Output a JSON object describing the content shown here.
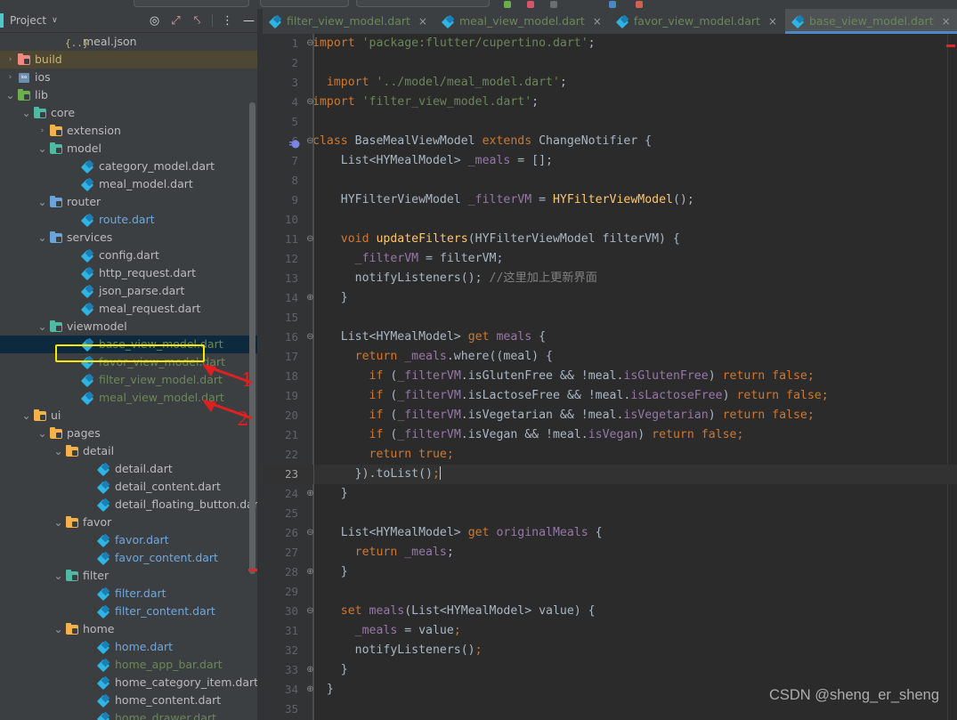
{
  "app": {
    "watermark": "CSDN @sheng_er_sheng"
  },
  "project_panel": {
    "title": "Project",
    "caret": "∨",
    "icons": [
      {
        "name": "target-icon",
        "glyph": "◎"
      },
      {
        "name": "expand-all-icon",
        "glyph": "⤢"
      },
      {
        "name": "collapse-all-icon",
        "glyph": "⤣"
      },
      {
        "name": "more-options-icon",
        "glyph": "⋮"
      },
      {
        "name": "minimize-icon",
        "glyph": "—"
      }
    ],
    "tree": [
      {
        "indent": 3,
        "arrow": "",
        "icon": "json-file-icon",
        "label": "meal.json",
        "color": "c-grey"
      },
      {
        "indent": 0,
        "arrow": ">",
        "icon": "folder-red-icon",
        "label": "build",
        "color": "c-yellow",
        "highlight": "build"
      },
      {
        "indent": 0,
        "arrow": ">",
        "icon": "ios-icon",
        "label": "ios",
        "color": "c-grey"
      },
      {
        "indent": 0,
        "arrow": "v",
        "icon": "folder-green-icon",
        "label": "lib",
        "color": "c-grey"
      },
      {
        "indent": 1,
        "arrow": "v",
        "icon": "folder-teal-icon",
        "label": "core",
        "color": "c-grey"
      },
      {
        "indent": 2,
        "arrow": ">",
        "icon": "folder-orange-icon",
        "label": "extension",
        "color": "c-grey"
      },
      {
        "indent": 2,
        "arrow": "v",
        "icon": "folder-teal-icon",
        "label": "model",
        "color": "c-grey"
      },
      {
        "indent": 4,
        "arrow": "",
        "icon": "dart-file-icon",
        "label": "category_model.dart",
        "color": "c-grey"
      },
      {
        "indent": 4,
        "arrow": "",
        "icon": "dart-file-icon",
        "label": "meal_model.dart",
        "color": "c-grey"
      },
      {
        "indent": 2,
        "arrow": "v",
        "icon": "folder-blue-icon",
        "label": "router",
        "color": "c-grey"
      },
      {
        "indent": 4,
        "arrow": "",
        "icon": "dart-file-icon",
        "label": "route.dart",
        "color": "c-blue"
      },
      {
        "indent": 2,
        "arrow": "v",
        "icon": "folder-blue-icon",
        "label": "services",
        "color": "c-grey"
      },
      {
        "indent": 4,
        "arrow": "",
        "icon": "dart-file-icon",
        "label": "config.dart",
        "color": "c-grey"
      },
      {
        "indent": 4,
        "arrow": "",
        "icon": "dart-file-icon",
        "label": "http_request.dart",
        "color": "c-grey"
      },
      {
        "indent": 4,
        "arrow": "",
        "icon": "dart-file-icon",
        "label": "json_parse.dart",
        "color": "c-grey"
      },
      {
        "indent": 4,
        "arrow": "",
        "icon": "dart-file-icon",
        "label": "meal_request.dart",
        "color": "c-grey"
      },
      {
        "indent": 2,
        "arrow": "v",
        "icon": "folder-teal-icon",
        "label": "viewmodel",
        "color": "c-grey"
      },
      {
        "indent": 4,
        "arrow": "",
        "icon": "dart-file-icon",
        "label": "base_view_model.dart",
        "color": "c-green",
        "selected": true
      },
      {
        "indent": 4,
        "arrow": "",
        "icon": "dart-file-icon",
        "label": "favor_view_model.dart",
        "color": "c-green"
      },
      {
        "indent": 4,
        "arrow": "",
        "icon": "dart-file-icon",
        "label": "filter_view_model.dart",
        "color": "c-green"
      },
      {
        "indent": 4,
        "arrow": "",
        "icon": "dart-file-icon",
        "label": "meal_view_model.dart",
        "color": "c-green"
      },
      {
        "indent": 1,
        "arrow": "v",
        "icon": "folder-orange-icon",
        "label": "ui",
        "color": "c-grey"
      },
      {
        "indent": 2,
        "arrow": "v",
        "icon": "folder-orange-icon",
        "label": "pages",
        "color": "c-grey"
      },
      {
        "indent": 3,
        "arrow": "v",
        "icon": "folder-orange-icon",
        "label": "detail",
        "color": "c-grey"
      },
      {
        "indent": 5,
        "arrow": "",
        "icon": "dart-file-icon",
        "label": "detail.dart",
        "color": "c-grey"
      },
      {
        "indent": 5,
        "arrow": "",
        "icon": "dart-file-icon",
        "label": "detail_content.dart",
        "color": "c-grey"
      },
      {
        "indent": 5,
        "arrow": "",
        "icon": "dart-file-icon",
        "label": "detail_floating_button.dart",
        "color": "c-grey"
      },
      {
        "indent": 3,
        "arrow": "v",
        "icon": "folder-orange-icon",
        "label": "favor",
        "color": "c-grey"
      },
      {
        "indent": 5,
        "arrow": "",
        "icon": "dart-file-icon",
        "label": "favor.dart",
        "color": "c-blue"
      },
      {
        "indent": 5,
        "arrow": "",
        "icon": "dart-file-icon",
        "label": "favor_content.dart",
        "color": "c-blue"
      },
      {
        "indent": 3,
        "arrow": "v",
        "icon": "folder-teal-icon",
        "label": "filter",
        "color": "c-grey"
      },
      {
        "indent": 5,
        "arrow": "",
        "icon": "dart-file-icon",
        "label": "filter.dart",
        "color": "c-blue"
      },
      {
        "indent": 5,
        "arrow": "",
        "icon": "dart-file-icon",
        "label": "filter_content.dart",
        "color": "c-blue"
      },
      {
        "indent": 3,
        "arrow": "v",
        "icon": "folder-orange-icon",
        "label": "home",
        "color": "c-grey"
      },
      {
        "indent": 5,
        "arrow": "",
        "icon": "dart-file-icon",
        "label": "home.dart",
        "color": "c-blue"
      },
      {
        "indent": 5,
        "arrow": "",
        "icon": "dart-file-icon",
        "label": "home_app_bar.dart",
        "color": "c-green"
      },
      {
        "indent": 5,
        "arrow": "",
        "icon": "dart-file-icon",
        "label": "home_category_item.dart",
        "color": "c-grey"
      },
      {
        "indent": 5,
        "arrow": "",
        "icon": "dart-file-icon",
        "label": "home_content.dart",
        "color": "c-grey"
      },
      {
        "indent": 5,
        "arrow": "",
        "icon": "dart-file-icon",
        "label": "home_drawer.dart",
        "color": "c-green"
      }
    ],
    "annotations": [
      {
        "name": "annotation-number-1",
        "label": "1"
      },
      {
        "name": "annotation-number-2",
        "label": "2"
      }
    ],
    "selection_highlight_color": "#ffe600",
    "annotation_color": "#e02020"
  },
  "editor": {
    "tabs": [
      {
        "label": "filter_view_model.dart",
        "color": "#6a8759",
        "active": false,
        "close": "×"
      },
      {
        "label": "meal_view_model.dart",
        "color": "#6a8759",
        "active": false,
        "close": "×"
      },
      {
        "label": "favor_view_model.dart",
        "color": "#6a8759",
        "active": false,
        "close": "×"
      },
      {
        "label": "base_view_model.dart",
        "color": "#6a8759",
        "active": true,
        "close": "×"
      }
    ],
    "current_line": 23,
    "lines": [
      {
        "n": 1,
        "fold": "⊖",
        "tokens": [
          {
            "t": "import ",
            "c": "k"
          },
          {
            "t": "'package:flutter/cupertino.dart'",
            "c": "s"
          },
          {
            "t": ";",
            "c": "pn"
          }
        ]
      },
      {
        "n": 2,
        "fold": "",
        "tokens": []
      },
      {
        "n": 3,
        "fold": "",
        "indent": 1,
        "tokens": [
          {
            "t": "import ",
            "c": "k"
          },
          {
            "t": "'../model/meal_model.dart'",
            "c": "s"
          },
          {
            "t": ";",
            "c": "pn"
          }
        ]
      },
      {
        "n": 4,
        "fold": "⊖",
        "tokens": [
          {
            "t": "import ",
            "c": "k"
          },
          {
            "t": "'filter_view_model.dart'",
            "c": "s"
          },
          {
            "t": ";",
            "c": "pn"
          }
        ]
      },
      {
        "n": 5,
        "fold": "",
        "tokens": []
      },
      {
        "n": 6,
        "fold": "⊖",
        "run": true,
        "tokens": [
          {
            "t": "class ",
            "c": "k"
          },
          {
            "t": "BaseMealViewModel ",
            "c": "ty"
          },
          {
            "t": "extends ",
            "c": "k"
          },
          {
            "t": "ChangeNotifier {",
            "c": "ty"
          }
        ]
      },
      {
        "n": 7,
        "fold": "",
        "indent": 2,
        "tokens": [
          {
            "t": "List<HYMealModel> ",
            "c": "ty"
          },
          {
            "t": "_meals",
            "c": "fd"
          },
          {
            "t": " = [];",
            "c": "pn"
          }
        ]
      },
      {
        "n": 8,
        "fold": "",
        "tokens": []
      },
      {
        "n": 9,
        "fold": "",
        "indent": 2,
        "tokens": [
          {
            "t": "HYFilterViewModel ",
            "c": "ty"
          },
          {
            "t": "_filterVM",
            "c": "fd"
          },
          {
            "t": " = ",
            "c": "pn"
          },
          {
            "t": "HYFilterViewModel",
            "c": "fn"
          },
          {
            "t": "();",
            "c": "pn"
          }
        ]
      },
      {
        "n": 10,
        "fold": "",
        "tokens": []
      },
      {
        "n": 11,
        "fold": "⊖",
        "indent": 2,
        "tokens": [
          {
            "t": "void ",
            "c": "k"
          },
          {
            "t": "updateFilters",
            "c": "fn"
          },
          {
            "t": "(HYFilterViewModel filterVM) {",
            "c": "pn"
          }
        ]
      },
      {
        "n": 12,
        "fold": "",
        "indent": 3,
        "tokens": [
          {
            "t": "_filterVM",
            "c": "fd"
          },
          {
            "t": " = filterVM;",
            "c": "pn"
          }
        ]
      },
      {
        "n": 13,
        "fold": "",
        "indent": 3,
        "tokens": [
          {
            "t": "notifyListeners",
            "c": "pn"
          },
          {
            "t": "(); ",
            "c": "pn"
          },
          {
            "t": "//这里加上更新界面",
            "c": "cm"
          }
        ]
      },
      {
        "n": 14,
        "fold": "⊕",
        "indent": 2,
        "tokens": [
          {
            "t": "}",
            "c": "pn"
          }
        ]
      },
      {
        "n": 15,
        "fold": "",
        "tokens": []
      },
      {
        "n": 16,
        "fold": "⊖",
        "indent": 2,
        "tokens": [
          {
            "t": "List<HYMealModel> ",
            "c": "ty"
          },
          {
            "t": "get ",
            "c": "k"
          },
          {
            "t": "meals",
            "c": "fd"
          },
          {
            "t": " {",
            "c": "pn"
          }
        ]
      },
      {
        "n": 17,
        "fold": "",
        "indent": 3,
        "tokens": [
          {
            "t": "return ",
            "c": "k"
          },
          {
            "t": "_meals",
            "c": "fd"
          },
          {
            "t": ".where((meal) {",
            "c": "pn"
          }
        ]
      },
      {
        "n": 18,
        "fold": "",
        "indent": 4,
        "tokens": [
          {
            "t": "if ",
            "c": "k"
          },
          {
            "t": "(",
            "c": "pn"
          },
          {
            "t": "_filterVM",
            "c": "fd"
          },
          {
            "t": ".isGlutenFree && !meal.",
            "c": "pn"
          },
          {
            "t": "isGlutenFree",
            "c": "fd"
          },
          {
            "t": ") ",
            "c": "pn"
          },
          {
            "t": "return false;",
            "c": "k"
          }
        ]
      },
      {
        "n": 19,
        "fold": "",
        "indent": 4,
        "tokens": [
          {
            "t": "if ",
            "c": "k"
          },
          {
            "t": "(",
            "c": "pn"
          },
          {
            "t": "_filterVM",
            "c": "fd"
          },
          {
            "t": ".isLactoseFree && !meal.",
            "c": "pn"
          },
          {
            "t": "isLactoseFree",
            "c": "fd"
          },
          {
            "t": ") ",
            "c": "pn"
          },
          {
            "t": "return false;",
            "c": "k"
          }
        ]
      },
      {
        "n": 20,
        "fold": "",
        "indent": 4,
        "tokens": [
          {
            "t": "if ",
            "c": "k"
          },
          {
            "t": "(",
            "c": "pn"
          },
          {
            "t": "_filterVM",
            "c": "fd"
          },
          {
            "t": ".isVegetarian && !meal.",
            "c": "pn"
          },
          {
            "t": "isVegetarian",
            "c": "fd"
          },
          {
            "t": ") ",
            "c": "pn"
          },
          {
            "t": "return false;",
            "c": "k"
          }
        ]
      },
      {
        "n": 21,
        "fold": "",
        "indent": 4,
        "tokens": [
          {
            "t": "if ",
            "c": "k"
          },
          {
            "t": "(",
            "c": "pn"
          },
          {
            "t": "_filterVM",
            "c": "fd"
          },
          {
            "t": ".isVegan && !meal.",
            "c": "pn"
          },
          {
            "t": "isVegan",
            "c": "fd"
          },
          {
            "t": ") ",
            "c": "pn"
          },
          {
            "t": "return false;",
            "c": "k"
          }
        ]
      },
      {
        "n": 22,
        "fold": "",
        "indent": 4,
        "tokens": [
          {
            "t": "return true;",
            "c": "k"
          }
        ]
      },
      {
        "n": 23,
        "fold": "",
        "indent": 3,
        "cur": true,
        "tokens": [
          {
            "t": "}).toList()",
            "c": "pn"
          },
          {
            "t": ";",
            "c": "k"
          }
        ],
        "caret": true
      },
      {
        "n": 24,
        "fold": "⊕",
        "indent": 2,
        "tokens": [
          {
            "t": "}",
            "c": "pn"
          }
        ]
      },
      {
        "n": 25,
        "fold": "",
        "tokens": []
      },
      {
        "n": 26,
        "fold": "⊖",
        "indent": 2,
        "tokens": [
          {
            "t": "List<HYMealModel> ",
            "c": "ty"
          },
          {
            "t": "get ",
            "c": "k"
          },
          {
            "t": "originalMeals",
            "c": "fd"
          },
          {
            "t": " {",
            "c": "pn"
          }
        ]
      },
      {
        "n": 27,
        "fold": "",
        "indent": 3,
        "tokens": [
          {
            "t": "return ",
            "c": "k"
          },
          {
            "t": "_meals",
            "c": "fd"
          },
          {
            "t": ";",
            "c": "pn"
          }
        ]
      },
      {
        "n": 28,
        "fold": "⊕",
        "indent": 2,
        "tokens": [
          {
            "t": "}",
            "c": "pn"
          }
        ]
      },
      {
        "n": 29,
        "fold": "",
        "tokens": []
      },
      {
        "n": 30,
        "fold": "⊖",
        "indent": 2,
        "tokens": [
          {
            "t": "set ",
            "c": "k"
          },
          {
            "t": "meals",
            "c": "fd"
          },
          {
            "t": "(List<HYMealModel> value) {",
            "c": "pn"
          }
        ]
      },
      {
        "n": 31,
        "fold": "",
        "indent": 3,
        "tokens": [
          {
            "t": "_meals",
            "c": "fd"
          },
          {
            "t": " = value",
            "c": "pn"
          },
          {
            "t": ";",
            "c": "k"
          }
        ]
      },
      {
        "n": 32,
        "fold": "",
        "indent": 3,
        "tokens": [
          {
            "t": "notifyListeners()",
            "c": "pn"
          },
          {
            "t": ";",
            "c": "k"
          }
        ]
      },
      {
        "n": 33,
        "fold": "⊕",
        "indent": 2,
        "tokens": [
          {
            "t": "}",
            "c": "pn"
          }
        ]
      },
      {
        "n": 34,
        "fold": "⊕",
        "indent": 1,
        "tokens": [
          {
            "t": "}",
            "c": "pn"
          }
        ]
      },
      {
        "n": 35,
        "fold": "",
        "tokens": []
      }
    ]
  }
}
